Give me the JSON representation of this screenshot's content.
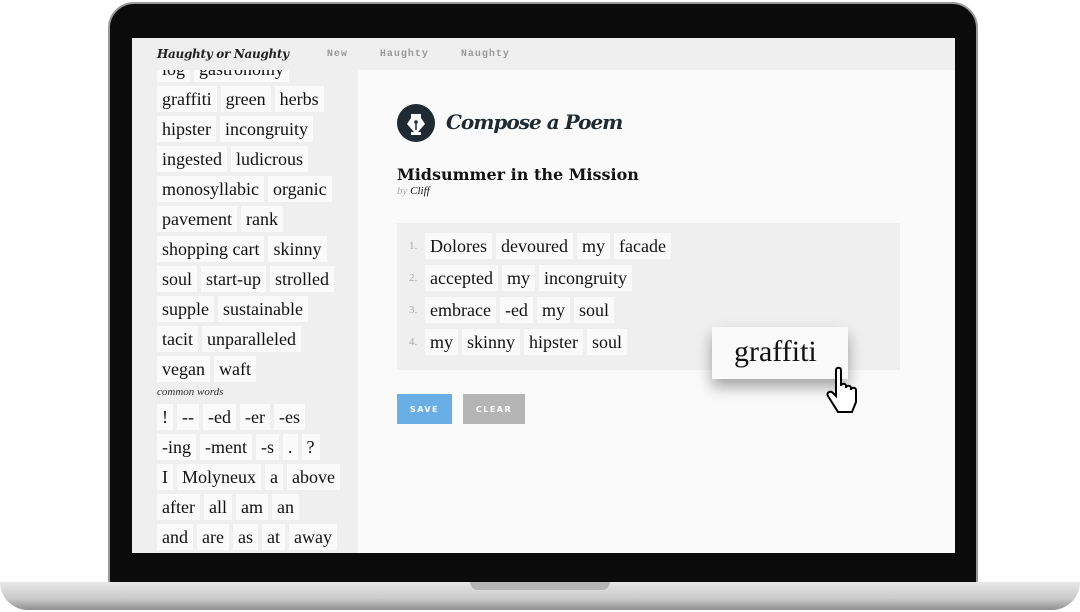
{
  "header": {
    "brand": "Haughty or Naughty",
    "nav": [
      "New",
      "Haughty",
      "Naughty"
    ]
  },
  "sidebar": {
    "word_rows": [
      [
        "log",
        "gastronomy"
      ],
      [
        "graffiti",
        "green",
        "herbs"
      ],
      [
        "hipster",
        "incongruity"
      ],
      [
        "ingested",
        "ludicrous"
      ],
      [
        "monosyllabic",
        "organic"
      ],
      [
        "pavement",
        "rank"
      ],
      [
        "shopping cart",
        "skinny"
      ],
      [
        "soul",
        "start-up",
        "strolled"
      ],
      [
        "supple",
        "sustainable"
      ],
      [
        "tacit",
        "unparalleled"
      ],
      [
        "vegan",
        "waft"
      ]
    ],
    "common_label": "common words",
    "common_rows": [
      [
        "!",
        "--",
        "-ed",
        "-er",
        "-es"
      ],
      [
        "-ing",
        "-ment",
        "-s",
        ".",
        "?"
      ],
      [
        "I",
        "Molyneux",
        "a",
        "above"
      ],
      [
        "after",
        "all",
        "am",
        "an"
      ],
      [
        "and",
        "are",
        "as",
        "at",
        "away"
      ]
    ]
  },
  "main": {
    "heading": "Compose a Poem",
    "poem_title": "Midsummer in the Mission",
    "by": "by",
    "author": "Cliff",
    "lines": [
      [
        "Dolores",
        "devoured",
        "my",
        "facade"
      ],
      [
        "accepted",
        "my",
        "incongruity"
      ],
      [
        "embrace",
        "-ed",
        "my",
        "soul"
      ],
      [
        "my",
        "skinny",
        "hipster",
        "soul"
      ]
    ],
    "line_numbers": [
      "1.",
      "2.",
      "3.",
      "4."
    ],
    "save_label": "SAVE",
    "clear_label": "CLEAR",
    "dragging_word": "graffiti"
  },
  "colors": {
    "save": "#6aaee6",
    "clear": "#b5b5b5",
    "logo": "#1f2a33"
  }
}
